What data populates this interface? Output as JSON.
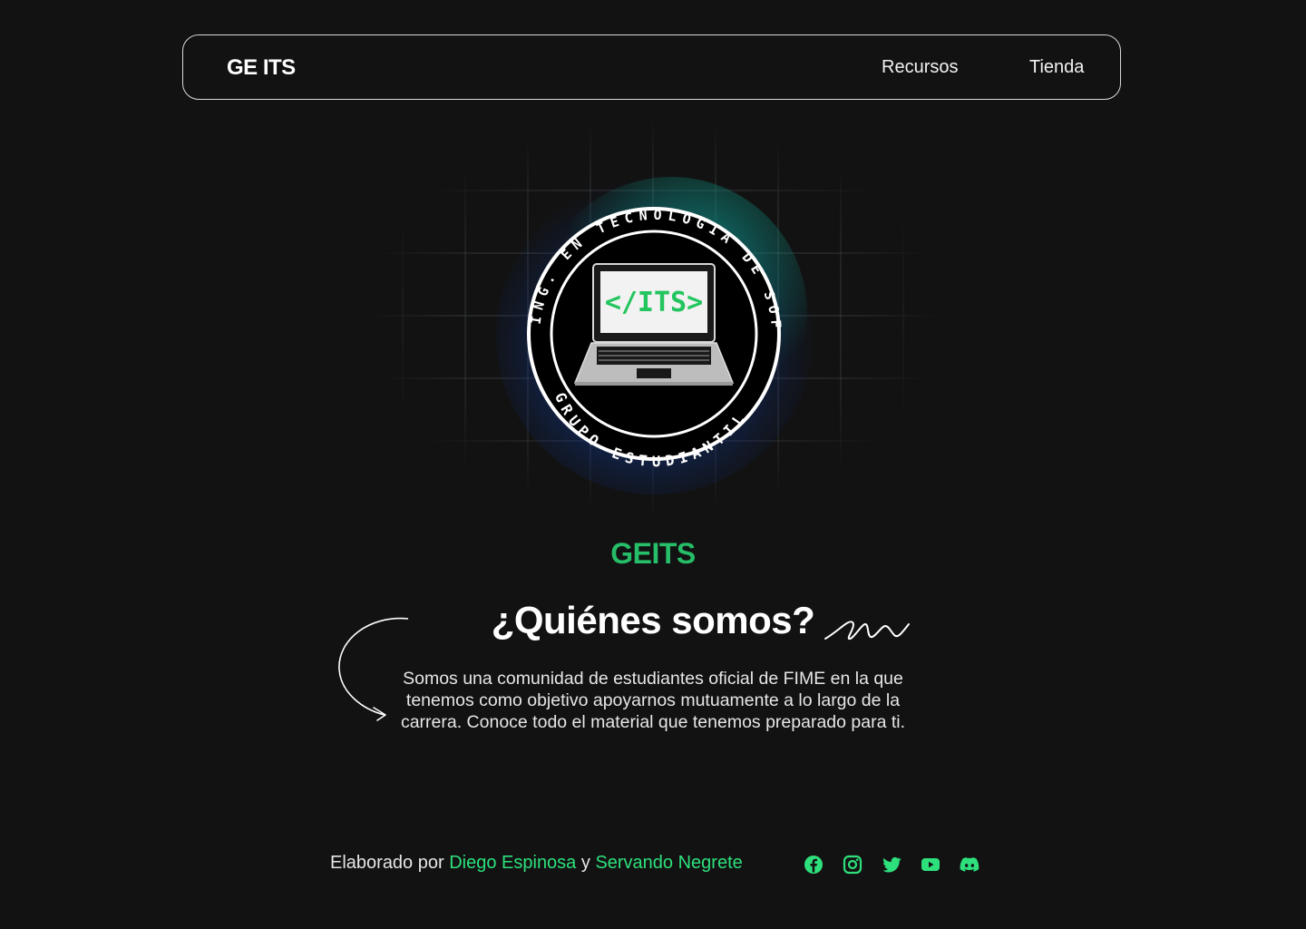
{
  "navbar": {
    "brand": "GE ITS",
    "links": [
      {
        "label": "Recursos"
      },
      {
        "label": "Tienda"
      }
    ]
  },
  "logo": {
    "top_arc_text": "ING. EN TECNOLOGIA DE SOFTWARE",
    "bottom_arc_text": "GRUPO ESTUDIANTIL",
    "screen_text": "</ITS>"
  },
  "brand_title": "GEITS",
  "about": {
    "heading": "¿Quiénes somos?",
    "description": "Somos una comunidad de estudiantes oficial de FIME en la que tenemos como objetivo apoyarnos mutuamente a lo largo de la carrera. Conoce todo el material que tenemos preparado para ti."
  },
  "footer": {
    "prefix": "Elaborado por",
    "author1": "Diego Espinosa",
    "joiner": "y",
    "author2": "Servando Negrete",
    "socials": [
      "facebook-icon",
      "instagram-icon",
      "twitter-icon",
      "youtube-icon",
      "discord-icon"
    ]
  },
  "colors": {
    "background": "#121212",
    "accent_green": "#2ee07c",
    "brand_green": "#1e9b56",
    "glow_blue": "#1d4fd8",
    "glow_teal": "#0e9b8a"
  }
}
